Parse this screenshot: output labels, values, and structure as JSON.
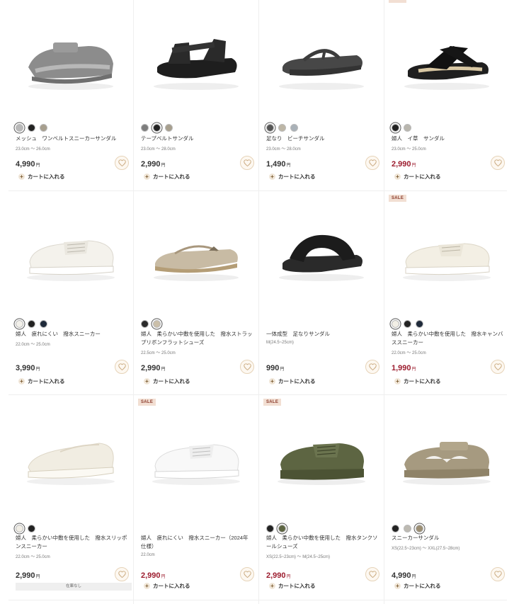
{
  "products": [
    {
      "sale": false,
      "swatches": [
        "#b9b9b9",
        "#222222",
        "#a79f8e"
      ],
      "selected": 0,
      "name": "メッシュ　ワンベルトスニーカーサンダル",
      "size": "23.0cm 〜 26.0cm",
      "price": "4,990",
      "red": false,
      "cart": "カートに入れる",
      "shoe": "grey-mesh-sandal"
    },
    {
      "sale": false,
      "swatches": [
        "#7d7d7d",
        "#222222",
        "#a79f8e"
      ],
      "selected": 1,
      "name": "テープベルトサンダル",
      "size": "23.0cm 〜 28.0cm",
      "price": "2,990",
      "red": false,
      "cart": "カートに入れる",
      "shoe": "black-tape-sandal"
    },
    {
      "sale": false,
      "swatches": [
        "#555555",
        "#bdb6a6",
        "#a9b1b8"
      ],
      "selected": 0,
      "name": "足なり　ビーチサンダル",
      "size": "23.0cm 〜 28.0cm",
      "price": "1,490",
      "red": false,
      "cart": "カートに入れる",
      "shoe": "grey-beach-sandal"
    },
    {
      "sale": true,
      "sale_label": "SALE",
      "swatches": [
        "#222222",
        "#b9b6ae"
      ],
      "selected": 0,
      "name": "婦人　イ草　サンダル",
      "size": "23.0cm 〜 25.0cm",
      "price": "2,990",
      "red": true,
      "cart": "カートに入れる",
      "shoe": "black-cross-sandal"
    },
    {
      "sale": false,
      "swatches": [
        "#f2f0ea",
        "#222222",
        "#1f2a3a"
      ],
      "selected": 0,
      "name": "婦人　疲れにくい　撥水スニーカー",
      "size": "22.0cm 〜 25.0cm",
      "price": "3,990",
      "red": false,
      "cart": "カートに入れる",
      "shoe": "white-sneaker"
    },
    {
      "sale": false,
      "swatches": [
        "#2a2a2a",
        "#cbbfa9"
      ],
      "selected": 1,
      "name": "婦人　柔らかい中敷を使用した　撥水ストラップリボンフラットシューズ",
      "size": "22.5cm 〜 25.0cm",
      "price": "2,990",
      "red": false,
      "cart": "カートに入れる",
      "shoe": "beige-flat"
    },
    {
      "sale": false,
      "swatches": [],
      "selected": -1,
      "name": "一体成型　足なりサンダル",
      "size": "M(24.5~25cm)",
      "price": "990",
      "red": false,
      "cart": "カートに入れる",
      "shoe": "black-slide"
    },
    {
      "sale": true,
      "sale_label": "SALE",
      "swatches": [
        "#f2efe6",
        "#222222",
        "#1f2a3a"
      ],
      "selected": 0,
      "name": "婦人　柔らかい中敷を使用した　撥水キャンバススニーカー",
      "size": "22.0cm 〜 25.0cm",
      "price": "1,990",
      "red": true,
      "cart": "カートに入れる",
      "shoe": "offwhite-canvas"
    },
    {
      "sale": false,
      "swatches": [
        "#f0ede5",
        "#222222"
      ],
      "selected": 0,
      "name": "婦人　柔らかい中敷を使用した　撥水スリッポンスニーカー",
      "size": "22.0cm 〜 25.0cm",
      "price": "2,990",
      "red": false,
      "cart": "",
      "nostock": "在庫なし",
      "shoe": "offwhite-slipon"
    },
    {
      "sale": true,
      "sale_label": "SALE",
      "swatches": [],
      "selected": -1,
      "name": "婦人　疲れにくい　撥水スニーカー（2024年仕様）",
      "size": "22.0cm",
      "price": "2,990",
      "red": true,
      "cart": "カートに入れる",
      "shoe": "white-sneaker-2"
    },
    {
      "sale": true,
      "sale_label": "SALE",
      "swatches": [
        "#222222",
        "#5d6542"
      ],
      "selected": 1,
      "name": "婦人　柔らかい中敷を使用した　撥水タンクソールシューズ",
      "size": "XS(22.5~23cm) 〜 M(24.5~25cm)",
      "price": "2,990",
      "red": true,
      "cart": "カートに入れる",
      "shoe": "olive-tank"
    },
    {
      "sale": false,
      "swatches": [
        "#222222",
        "#bdbab2",
        "#9c8f74"
      ],
      "selected": 2,
      "name": "スニーカーサンダル",
      "size": "XS(22.5~23cm) 〜 XXL(27.5~28cm)",
      "price": "4,990",
      "red": false,
      "cart": "カートに入れる",
      "shoe": "beige-sneaker-sandal"
    }
  ],
  "yen": "円"
}
